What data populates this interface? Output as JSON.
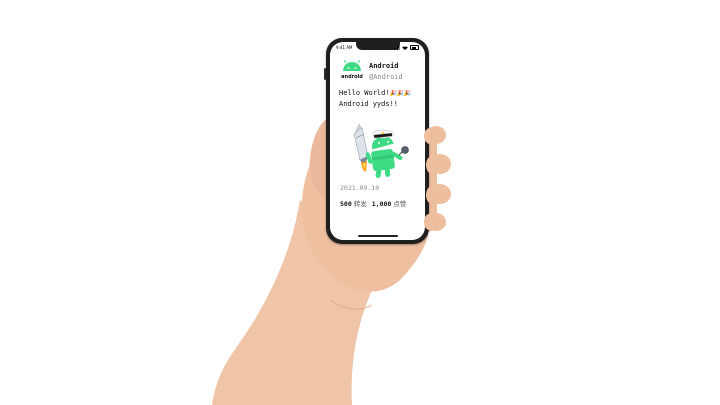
{
  "status_bar": {
    "time": "9:41 AM"
  },
  "profile": {
    "logo_text": "android",
    "display_name": "Android",
    "handle": "@Android"
  },
  "tweet": {
    "line1": "Hello World!",
    "line1_emoji": "🎉🎉🎉",
    "line2": "Android yyds!!"
  },
  "meta": {
    "date": "2021.09.10",
    "retweets_count": "500",
    "retweets_label": "转发",
    "likes_count": "1,000",
    "likes_label": "点赞"
  },
  "colors": {
    "android_green": "#3ddc84",
    "skin": "#efc2a4",
    "phone_frame": "#1f1f1f"
  },
  "icons": [
    "android-logo-icon",
    "signal-icon",
    "wifi-icon",
    "battery-icon"
  ]
}
